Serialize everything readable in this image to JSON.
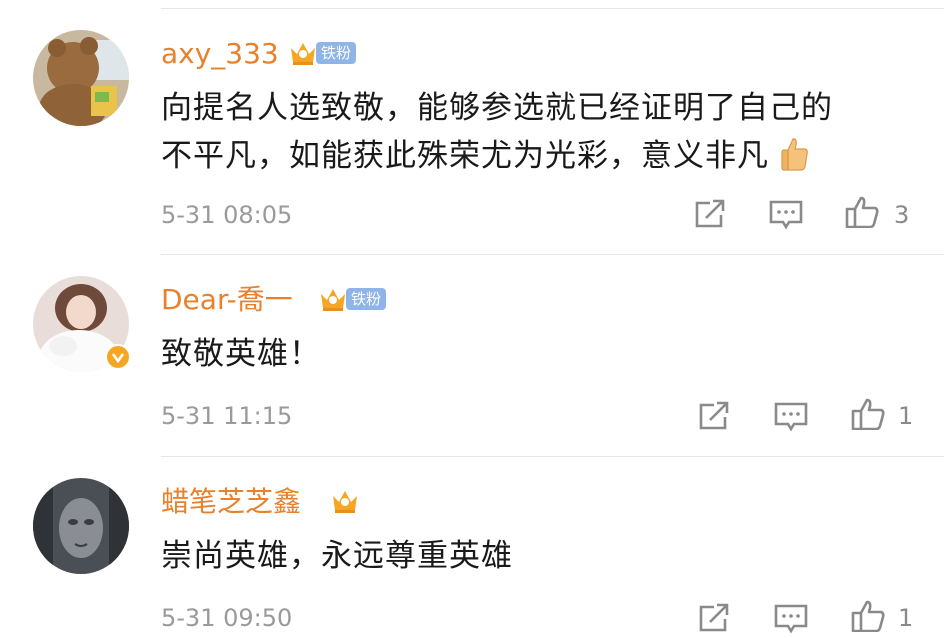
{
  "comments": [
    {
      "username": "axy_333",
      "fan_badge": "铁粉",
      "text_line1": "向提名人选致敬，能够参选就已经证明了自己的",
      "text_line2": "不平凡，如能获此殊荣尤为光彩，意义非凡",
      "time": "5-31 08:05",
      "likes": "3"
    },
    {
      "username": "Dear-喬一",
      "fan_badge": "铁粉",
      "text_line1": "致敬英雄！",
      "time": "5-31 11:15",
      "likes": "1"
    },
    {
      "username": "蜡笔芝芝鑫",
      "text_line1": "崇尚英雄，永远尊重英雄",
      "time": "5-31 09:50",
      "likes": "1"
    }
  ],
  "colors": {
    "username": "#e8812c",
    "crown": "#f5a623",
    "fan_badge_bg": "#8fb4e8",
    "icon": "#8a8a8a"
  }
}
